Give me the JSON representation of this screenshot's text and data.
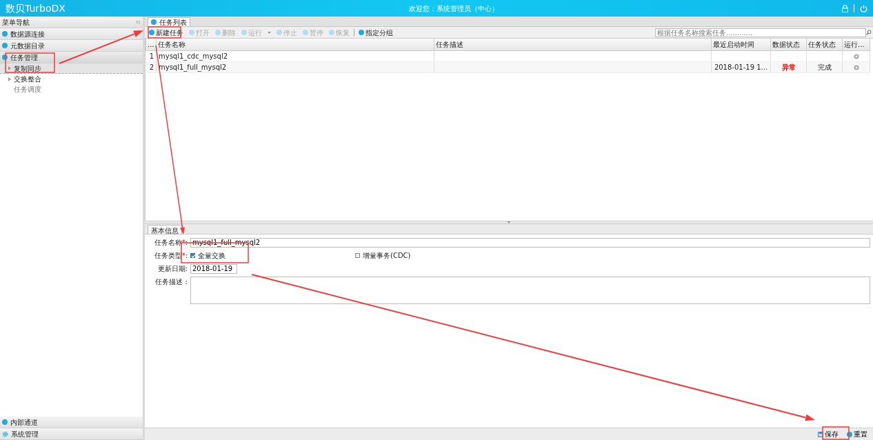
{
  "header": {
    "title": "数贝TurboDX",
    "welcome": "欢迎您：系统管理员（中心）"
  },
  "sidebar": {
    "title": "菜单导航",
    "panels": [
      {
        "label": "数据源连接",
        "expanded": false
      },
      {
        "label": "元数据目录",
        "expanded": false
      },
      {
        "label": "任务管理",
        "expanded": true,
        "tree": [
          {
            "label": "复制同步",
            "selected": true,
            "expandable": true
          },
          {
            "label": "交换整合",
            "selected": false,
            "expandable": true
          },
          {
            "label": "任务调度",
            "selected": false,
            "expandable": false
          }
        ]
      }
    ],
    "bottom_panels": [
      {
        "label": "内部通道",
        "kind": "circle"
      },
      {
        "label": "系统管理",
        "kind": "gear"
      }
    ]
  },
  "list_tabs": [
    {
      "label": "任务列表",
      "selected": true
    }
  ],
  "toolbar": [
    {
      "label": "新建任务",
      "disabled": false
    },
    {
      "label": "打开",
      "disabled": true
    },
    {
      "label": "删除",
      "disabled": true
    },
    {
      "label": "运行",
      "disabled": true,
      "dropdown": true
    },
    {
      "label": "停止",
      "disabled": true
    },
    {
      "label": "暂停",
      "disabled": true
    },
    {
      "label": "恢复",
      "disabled": true
    },
    {
      "label": "指定分组",
      "disabled": false,
      "separator_before": true
    }
  ],
  "search": {
    "placeholder": "根据任务名称搜索任务............"
  },
  "table": {
    "columns": [
      "...",
      "任务名称",
      "任务描述",
      "最近启动时间",
      "数据状态",
      "任务状态",
      "运行..."
    ],
    "rows": [
      {
        "num": "1",
        "name": "mysql1_cdc_mysql2"
      },
      {
        "num": "2",
        "name": "mysql1_full_mysql2",
        "last_start": "2018-01-19 1...",
        "data_status": {
          "text": "异常",
          "color": "#ee0000"
        },
        "task_status": "完成"
      }
    ]
  },
  "form_tabs": [
    {
      "label": "基本信息",
      "selected": true
    }
  ],
  "form": {
    "name": {
      "label": "任务名称",
      "mark": "*",
      "colon": ":",
      "value": "mysql1_full_mysql2"
    },
    "type": {
      "label": "任务类型",
      "mark": "*",
      "colon": ":",
      "options": [
        {
          "label": "全量交换",
          "checked": true
        },
        {
          "label": "增量事务(CDC)",
          "checked": false
        }
      ]
    },
    "date": {
      "label": "更新日期",
      "colon": ":",
      "value": "2018-01-19"
    },
    "description": {
      "label": "任务描述",
      "colon": " :"
    }
  },
  "footer_buttons": [
    {
      "label": "保存",
      "kind": "save"
    },
    {
      "label": "重置",
      "kind": "reset"
    }
  ]
}
